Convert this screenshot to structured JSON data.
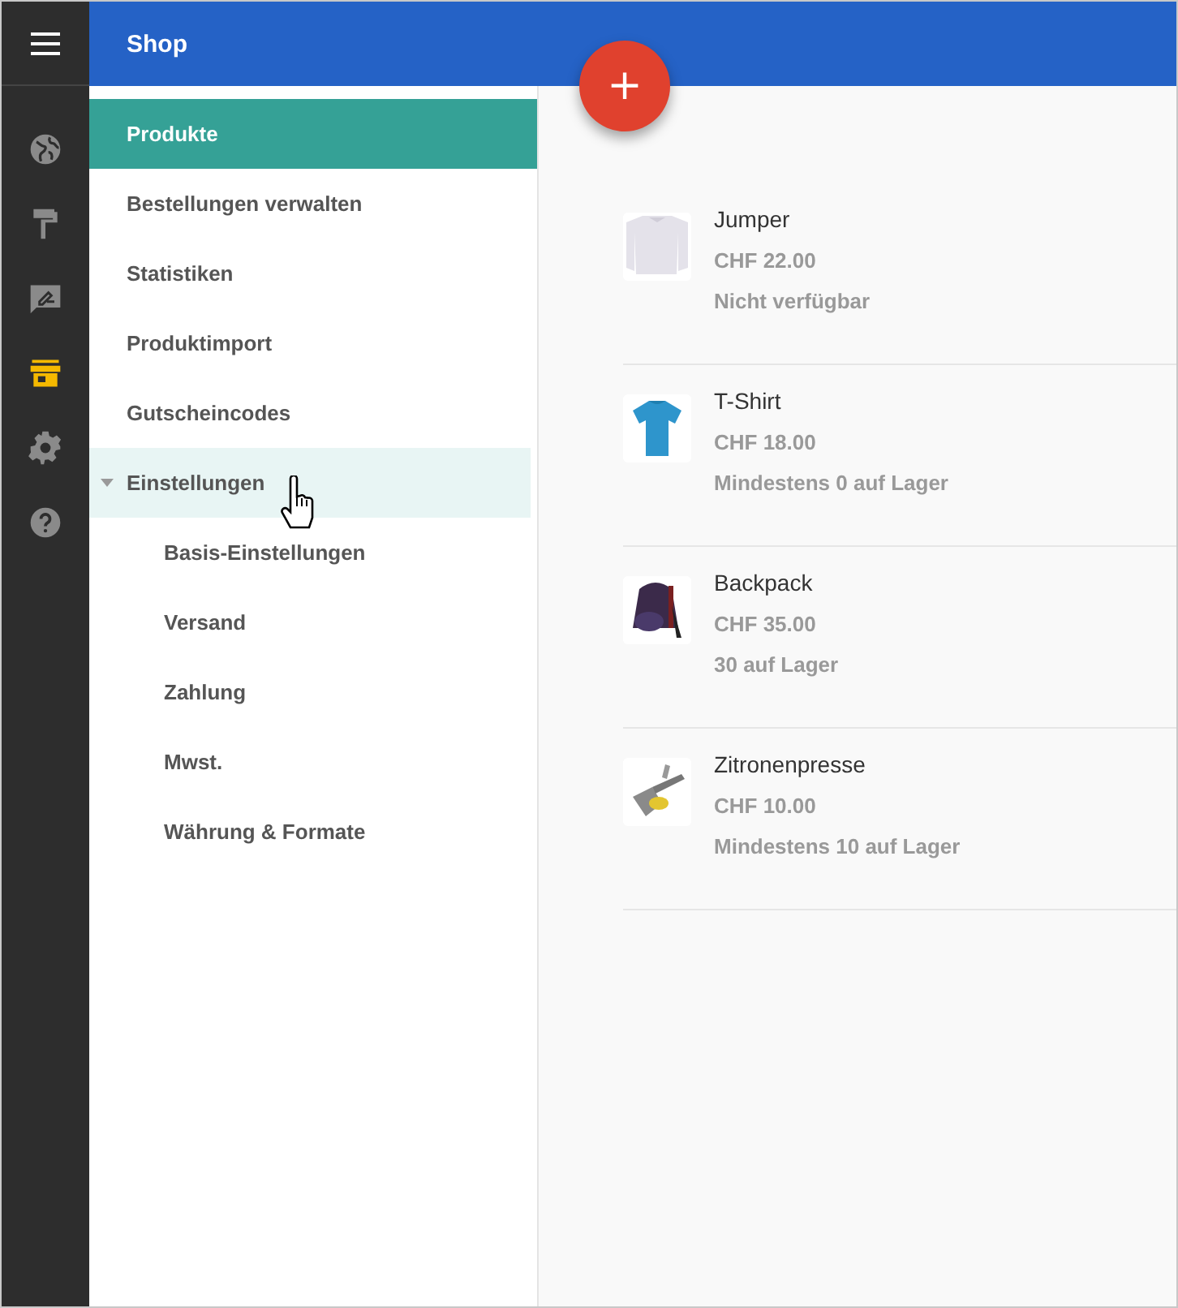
{
  "header": {
    "title": "Shop"
  },
  "rail": [
    {
      "selected": false
    },
    {
      "selected": false
    },
    {
      "selected": false
    },
    {
      "selected": true
    },
    {
      "selected": false
    },
    {
      "selected": false
    }
  ],
  "menu": [
    {
      "label": "Produkte",
      "selected": true
    },
    {
      "label": "Bestellungen verwalten",
      "selected": false
    },
    {
      "label": "Statistiken",
      "selected": false
    },
    {
      "label": "Produktimport",
      "selected": false
    },
    {
      "label": "Gutscheincodes",
      "selected": false
    },
    {
      "label": "Einstellungen",
      "selected": false,
      "hovered": true,
      "expanded": true,
      "children": [
        {
          "label": "Basis-Einstellungen",
          "selected": false
        },
        {
          "label": "Versand",
          "selected": false
        },
        {
          "label": "Zahlung",
          "selected": false
        },
        {
          "label": "Mwst.",
          "selected": false
        },
        {
          "label": "Währung & Formate",
          "selected": false
        }
      ]
    }
  ],
  "add_button": {
    "label": "+"
  },
  "products": [
    {
      "name": "Jumper",
      "price": "CHF 22.00",
      "stock": "Nicht verfügbar"
    },
    {
      "name": "T-Shirt",
      "price": "CHF 18.00",
      "stock": "Mindestens 0 auf Lager"
    },
    {
      "name": "Backpack",
      "price": "CHF 35.00",
      "stock": "30 auf Lager"
    },
    {
      "name": "Zitronenpresse",
      "price": "CHF 10.00",
      "stock": "Mindestens 10 auf Lager"
    }
  ]
}
